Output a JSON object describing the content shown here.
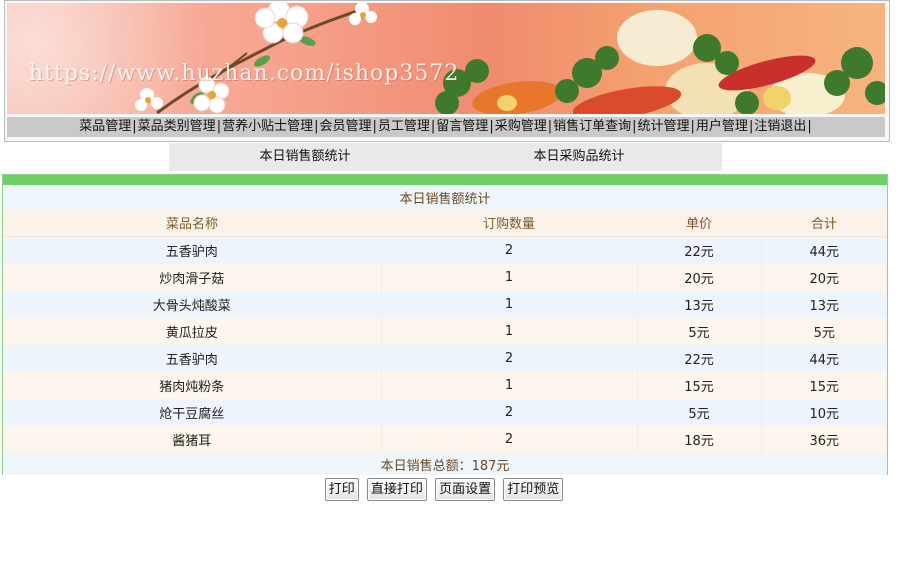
{
  "banner": {
    "watermark": "https://www.huzhan.com/ishop3572"
  },
  "nav": {
    "items": [
      "菜品管理",
      "菜品类别管理",
      "营养小贴士管理",
      "会员管理",
      "员工管理",
      "留言管理",
      "采购管理",
      "销售订单查询",
      "统计管理",
      "用户管理",
      "注销退出"
    ],
    "separator": "|"
  },
  "tabs": {
    "sales": "本日销售额统计",
    "purchase": "本日采购品统计"
  },
  "table": {
    "caption": "本日销售额统计",
    "headers": [
      "菜品名称",
      "订购数量",
      "单价",
      "合计"
    ],
    "rows": [
      [
        "五香驴肉",
        "2",
        "22元",
        "44元"
      ],
      [
        "炒肉滑子菇",
        "1",
        "20元",
        "20元"
      ],
      [
        "大骨头炖酸菜",
        "1",
        "13元",
        "13元"
      ],
      [
        "黄瓜拉皮",
        "1",
        "5元",
        "5元"
      ],
      [
        "五香驴肉",
        "2",
        "22元",
        "44元"
      ],
      [
        "猪肉炖粉条",
        "1",
        "15元",
        "15元"
      ],
      [
        "炝干豆腐丝",
        "2",
        "5元",
        "10元"
      ],
      [
        "酱猪耳",
        "2",
        "18元",
        "36元"
      ]
    ],
    "total": "本日销售总额：187元"
  },
  "buttons": {
    "print": "打印",
    "direct_print": "直接打印",
    "page_setup": "页面设置",
    "print_preview": "打印预览"
  },
  "colors": {
    "panel_top": "#6fcf67",
    "nav_bg": "#c9c9c9",
    "row_blue": "#edf4fb",
    "row_cream": "#fdf6ee",
    "caption_text": "#6b4a26"
  }
}
